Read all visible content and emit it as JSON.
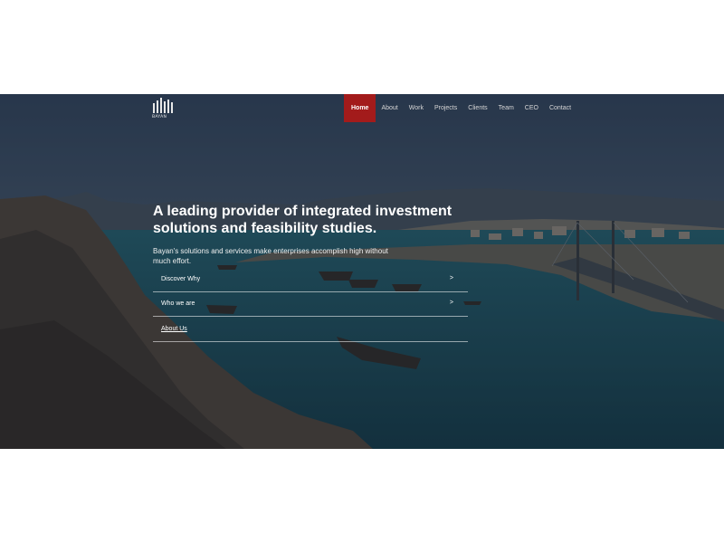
{
  "brand": {
    "logo_text": "BAYAN"
  },
  "nav": {
    "items": [
      {
        "label": "Home",
        "active": true
      },
      {
        "label": "About"
      },
      {
        "label": "Work"
      },
      {
        "label": "Projects"
      },
      {
        "label": "Clients"
      },
      {
        "label": "Team"
      },
      {
        "label": "CEO"
      },
      {
        "label": "Contact"
      }
    ]
  },
  "hero": {
    "headline": "A leading provider of integrated investment solutions and feasibility studies.",
    "subtext": "Bayan's solutions and services make enterprises accomplish high without much effort.",
    "links": [
      {
        "label": "Discover Why",
        "arrow": ">"
      },
      {
        "label": "Who we are",
        "arrow": ">"
      },
      {
        "label": "About Us"
      }
    ]
  },
  "colors": {
    "accent": "#a31b1b",
    "overlay": "#1f2a38"
  }
}
